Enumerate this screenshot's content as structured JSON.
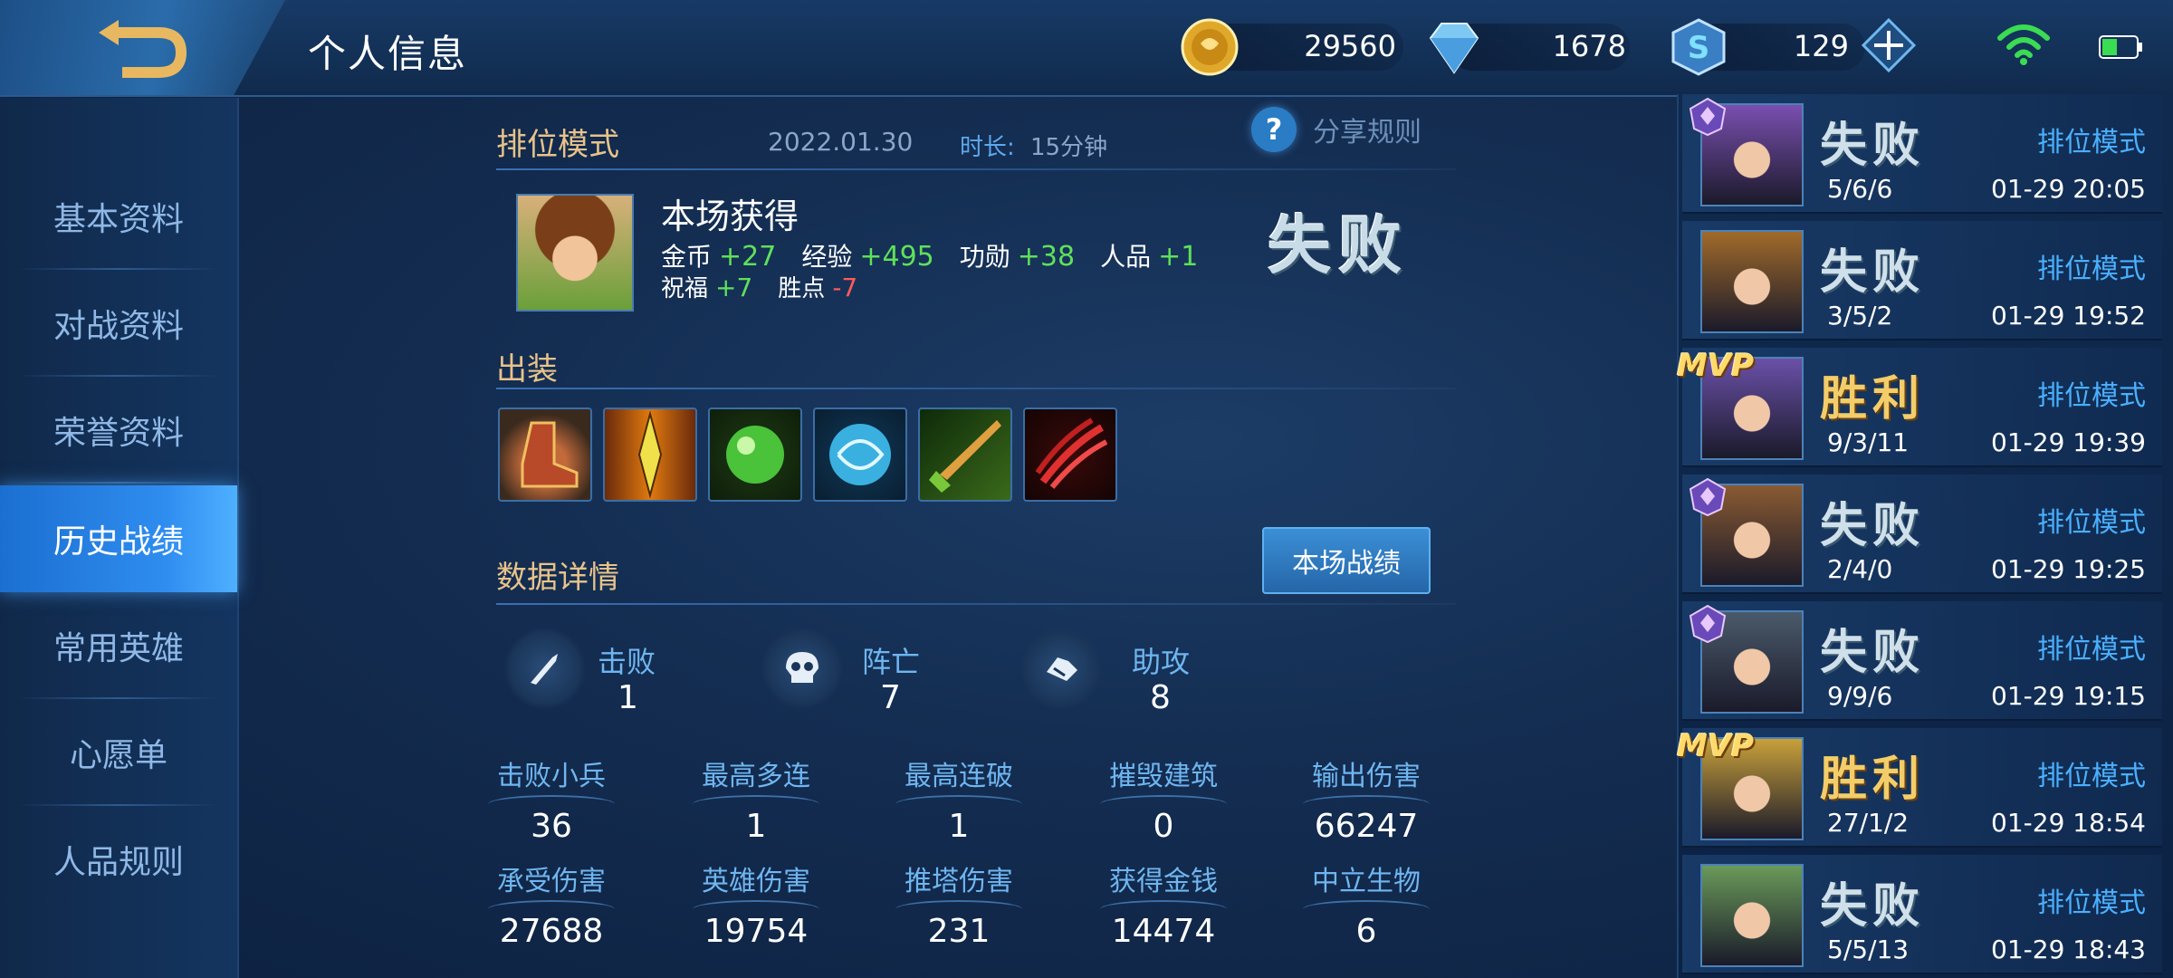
{
  "header": {
    "title": "个人信息",
    "gold": "29560",
    "diamonds": "1678",
    "coupons": "129"
  },
  "nav": {
    "items": [
      {
        "label": "基本资料"
      },
      {
        "label": "对战资料"
      },
      {
        "label": "荣誉资料"
      },
      {
        "label": "历史战绩",
        "active": true
      },
      {
        "label": "常用英雄"
      },
      {
        "label": "心愿单"
      },
      {
        "label": "人品规则"
      }
    ]
  },
  "match_detail": {
    "mode": "排位模式",
    "date": "2022.01.30",
    "duration_label": "时长:",
    "duration_value": "15分钟",
    "share_label": "分享规则",
    "share_icon": "?",
    "gain_title": "本场获得",
    "gains": {
      "gold_label": "金币",
      "gold": "+27",
      "exp_label": "经验",
      "exp": "+495",
      "merit_label": "功勋",
      "merit": "+38",
      "rep_label": "人品",
      "rep": "+1",
      "bless_label": "祝福",
      "bless": "+7",
      "win_points_label": "胜点",
      "win_points": "-7"
    },
    "result": "失败",
    "equipment_title": "出装",
    "equipment": [
      {
        "icon": "boots-icon",
        "color": "#b84a2a"
      },
      {
        "icon": "flame-blade-icon",
        "color": "#e08a1a"
      },
      {
        "icon": "green-orb-icon",
        "color": "#3aa63a"
      },
      {
        "icon": "blue-orb-icon",
        "color": "#3ab0e0"
      },
      {
        "icon": "green-sword-icon",
        "color": "#5aa832"
      },
      {
        "icon": "red-claw-icon",
        "color": "#c02a2a"
      }
    ],
    "data_title": "数据详情",
    "stats_button": "本场战绩",
    "kda": {
      "kills_label": "击败",
      "kills": "1",
      "deaths_label": "阵亡",
      "deaths": "7",
      "assists_label": "助攻",
      "assists": "8"
    },
    "stats": [
      {
        "label": "击败小兵",
        "value": "36"
      },
      {
        "label": "最高多连",
        "value": "1"
      },
      {
        "label": "最高连破",
        "value": "1"
      },
      {
        "label": "摧毁建筑",
        "value": "0"
      },
      {
        "label": "输出伤害",
        "value": "66247"
      },
      {
        "label": "承受伤害",
        "value": "27688"
      },
      {
        "label": "英雄伤害",
        "value": "19754"
      },
      {
        "label": "推塔伤害",
        "value": "231"
      },
      {
        "label": "获得金钱",
        "value": "14474"
      },
      {
        "label": "中立生物",
        "value": "6"
      }
    ]
  },
  "history": [
    {
      "result": "失败",
      "win": false,
      "mode": "排位模式",
      "kda": "5/6/6",
      "time": "01-29 20:05",
      "badge": "rank",
      "hero_color": "#7a4fb0"
    },
    {
      "result": "失败",
      "win": false,
      "mode": "排位模式",
      "kda": "3/5/2",
      "time": "01-29 19:52",
      "badge": "none",
      "hero_color": "#a06a2a"
    },
    {
      "result": "胜利",
      "win": true,
      "mode": "排位模式",
      "kda": "9/3/11",
      "time": "01-29 19:39",
      "badge": "mvp",
      "mvp_text": "MVP",
      "hero_color": "#6a50a8"
    },
    {
      "result": "失败",
      "win": false,
      "mode": "排位模式",
      "kda": "2/4/0",
      "time": "01-29 19:25",
      "badge": "rank",
      "hero_color": "#8a5a32"
    },
    {
      "result": "失败",
      "win": false,
      "mode": "排位模式",
      "kda": "9/9/6",
      "time": "01-29 19:15",
      "badge": "rank",
      "hero_color": "#4a5a6a"
    },
    {
      "result": "胜利",
      "win": true,
      "mode": "排位模式",
      "kda": "27/1/2",
      "time": "01-29 18:54",
      "badge": "mvp",
      "mvp_text": "MVP",
      "hero_color": "#c8a03a"
    },
    {
      "result": "失败",
      "win": false,
      "mode": "排位模式",
      "kda": "5/5/13",
      "time": "01-29 18:43",
      "badge": "none",
      "hero_color": "#6a9a5a"
    }
  ]
}
